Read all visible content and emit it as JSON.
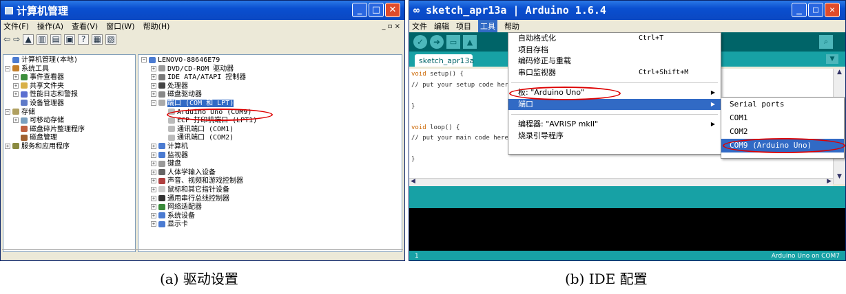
{
  "w1": {
    "title": "计算机管理",
    "menu": [
      "文件(F)",
      "操作(A)",
      "查看(V)",
      "窗口(W)",
      "帮助(H)"
    ],
    "left": [
      {
        "t": "计算机管理(本地)",
        "d": 0,
        "pm": "",
        "c": "#4b7bd1"
      },
      {
        "t": "系统工具",
        "d": 0,
        "pm": "−",
        "c": "#c47f2a"
      },
      {
        "t": "事件查看器",
        "d": 1,
        "pm": "+",
        "c": "#3c8e3c"
      },
      {
        "t": "共享文件夹",
        "d": 1,
        "pm": "+",
        "c": "#d8b048"
      },
      {
        "t": "性能日志和警报",
        "d": 1,
        "pm": "+",
        "c": "#5a6fd0"
      },
      {
        "t": "设备管理器",
        "d": 1,
        "pm": "",
        "c": "#5f7ac8"
      },
      {
        "t": "存储",
        "d": 0,
        "pm": "−",
        "c": "#b0a060"
      },
      {
        "t": "可移动存储",
        "d": 1,
        "pm": "+",
        "c": "#7aa0c0"
      },
      {
        "t": "磁盘碎片整理程序",
        "d": 1,
        "pm": "",
        "c": "#c06040"
      },
      {
        "t": "磁盘管理",
        "d": 1,
        "pm": "",
        "c": "#a06030"
      },
      {
        "t": "服务和应用程序",
        "d": 0,
        "pm": "+",
        "c": "#8a8a40"
      }
    ],
    "right": [
      {
        "t": "LENOVO-88646E79",
        "d": 0,
        "pm": "−",
        "c": "#4b7bd1"
      },
      {
        "t": "DVD/CD-ROM 驱动器",
        "d": 1,
        "pm": "+",
        "c": "#999"
      },
      {
        "t": "IDE ATA/ATAPI 控制器",
        "d": 1,
        "pm": "+",
        "c": "#7a7a7a"
      },
      {
        "t": "处理器",
        "d": 1,
        "pm": "+",
        "c": "#444"
      },
      {
        "t": "磁盘驱动器",
        "d": 1,
        "pm": "+",
        "c": "#888"
      },
      {
        "t": "端口 (COM 和 LPT)",
        "d": 1,
        "pm": "−",
        "c": "#aaa",
        "sel": true
      },
      {
        "t": "Arduino Uno (COM9)",
        "d": 2,
        "pm": "",
        "c": "#bbb"
      },
      {
        "t": "ECP 打印机端口 (LPT1)",
        "d": 2,
        "pm": "",
        "c": "#bbb"
      },
      {
        "t": "通讯端口 (COM1)",
        "d": 2,
        "pm": "",
        "c": "#bbb"
      },
      {
        "t": "通讯端口 (COM2)",
        "d": 2,
        "pm": "",
        "c": "#bbb"
      },
      {
        "t": "计算机",
        "d": 1,
        "pm": "+",
        "c": "#4b7bd1"
      },
      {
        "t": "监视器",
        "d": 1,
        "pm": "+",
        "c": "#4b7bd1"
      },
      {
        "t": "键盘",
        "d": 1,
        "pm": "+",
        "c": "#999"
      },
      {
        "t": "人体学输入设备",
        "d": 1,
        "pm": "+",
        "c": "#666"
      },
      {
        "t": "声音、视频和游戏控制器",
        "d": 1,
        "pm": "+",
        "c": "#b04040"
      },
      {
        "t": "鼠标和其它指针设备",
        "d": 1,
        "pm": "+",
        "c": "#ccc"
      },
      {
        "t": "通用串行总线控制器",
        "d": 1,
        "pm": "+",
        "c": "#333"
      },
      {
        "t": "网络适配器",
        "d": 1,
        "pm": "+",
        "c": "#3a8a3a"
      },
      {
        "t": "系统设备",
        "d": 1,
        "pm": "+",
        "c": "#4b7bd1"
      },
      {
        "t": "显示卡",
        "d": 1,
        "pm": "+",
        "c": "#4b7bd1"
      }
    ]
  },
  "w2": {
    "title": "∞ sketch_apr13a | Arduino 1.6.4",
    "menu": [
      "文件",
      "编辑",
      "项目",
      "工具",
      "帮助"
    ],
    "tab": "sketch_apr13a",
    "code": [
      "void setup() {",
      "  // put your setup code here, to run once:",
      "",
      "}",
      "",
      "void loop() {",
      "  // put your main code here, to run repeatedly:",
      "",
      "}"
    ],
    "tools": [
      {
        "t": "自动格式化",
        "sc": "Ctrl+T"
      },
      {
        "t": "项目存档"
      },
      {
        "t": "编码修正与重载"
      },
      {
        "t": "串口监视器",
        "sc": "Ctrl+Shift+M"
      },
      {
        "sep": true
      },
      {
        "t": "板: \"Arduino Uno\"",
        "ar": "▶"
      },
      {
        "t": "端口",
        "ar": "▶",
        "hl": true
      },
      {
        "sep": true
      },
      {
        "t": "编程器: \"AVRISP mkII\"",
        "ar": "▶"
      },
      {
        "t": "烧录引导程序"
      }
    ],
    "ports": [
      {
        "t": "Serial ports"
      },
      {
        "t": "COM1"
      },
      {
        "t": "COM2"
      },
      {
        "t": "COM9 (Arduino Uno)",
        "hl": true
      }
    ],
    "footer_left": "1",
    "footer_right": "Arduino Uno on COM7"
  },
  "captions": {
    "a": "(a)  驱动设置",
    "b": "(b)  IDE 配置"
  }
}
